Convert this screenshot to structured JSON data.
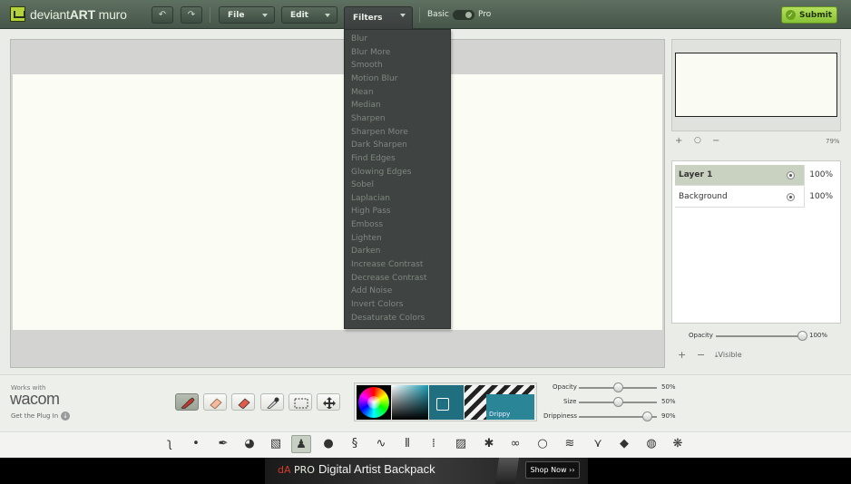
{
  "header": {
    "logo_word_a": "deviant",
    "logo_word_b": "ART",
    "logo_word_c": " muro",
    "undo_icon": "undo-icon",
    "redo_icon": "redo-icon",
    "file_label": "File",
    "edit_label": "Edit",
    "filters_label": "Filters",
    "mode_basic": "Basic",
    "mode_pro": "Pro",
    "submit_label": "Submit"
  },
  "filters_menu": {
    "items": [
      "Blur",
      "Blur More",
      "Smooth",
      "Motion Blur",
      "Mean",
      "Median",
      "Sharpen",
      "Sharpen More",
      "Dark Sharpen",
      "Find Edges",
      "Glowing Edges",
      "Sobel",
      "Laplacian",
      "High Pass",
      "Emboss",
      "Lighten",
      "Darken",
      "Increase Contrast",
      "Decrease Contrast",
      "Add Noise",
      "Invert Colors",
      "Desaturate Colors"
    ]
  },
  "preview": {
    "zoom_in_icon": "+",
    "zoom_reset_icon": "○",
    "zoom_out_icon": "−",
    "zoom_level": "79%"
  },
  "layers": {
    "items": [
      {
        "name": "Layer 1",
        "opacity": "100%",
        "selected": true
      },
      {
        "name": "Background",
        "opacity": "100%",
        "selected": false
      }
    ],
    "opacity_label": "Opacity",
    "opacity_value": "100%",
    "add_icon": "+",
    "remove_icon": "−",
    "visible_label": "Visible"
  },
  "wacom": {
    "works_with": "Works with",
    "brand": "wacom",
    "plugin_label": "Get the Plug In"
  },
  "brush_settings": {
    "opacity_label": "Opacity",
    "opacity_value": "50%",
    "size_label": "Size",
    "size_value": "50%",
    "drippiness_label": "Drippiness",
    "drippiness_value": "90%",
    "brush_name": "Drippy"
  },
  "ad": {
    "brand_a": "dA",
    "brand_b": " PRO",
    "title": "Digital Artist Backpack",
    "cta": "Shop Now ››"
  }
}
